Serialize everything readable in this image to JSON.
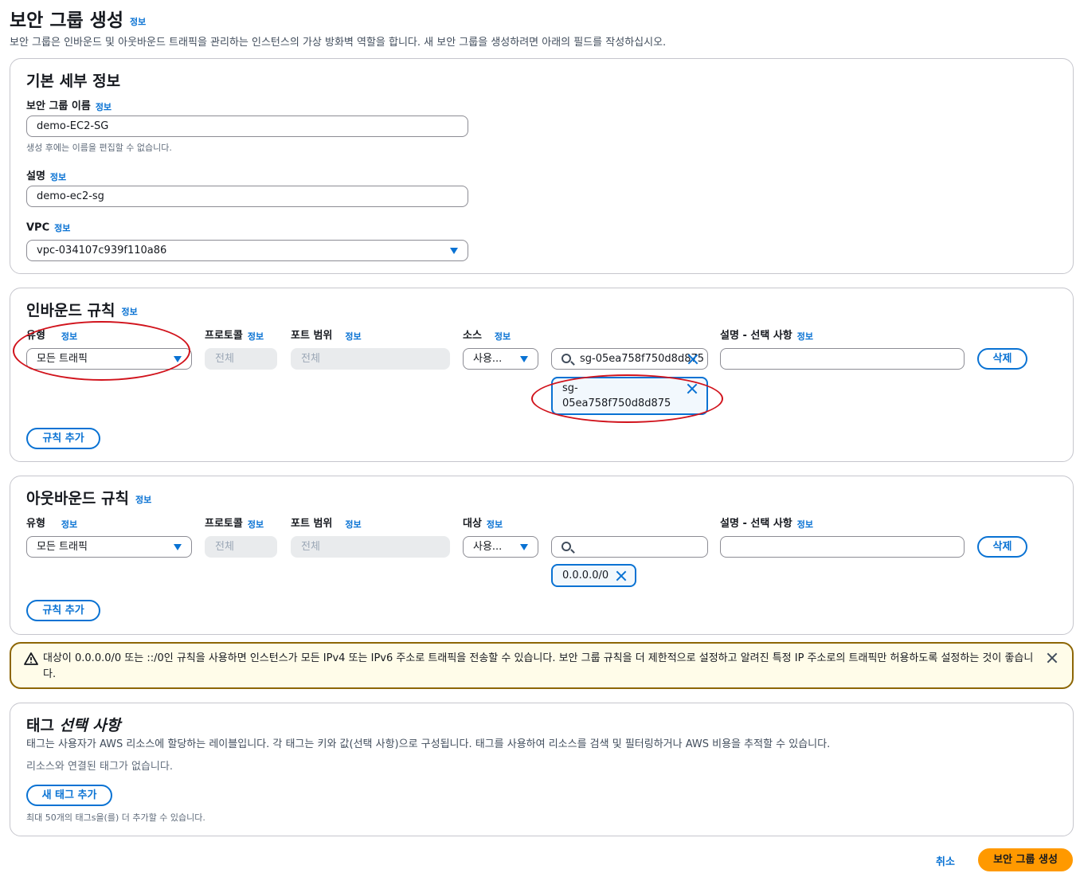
{
  "header": {
    "title": "보안 그룹 생성",
    "info": "정보",
    "description": "보안 그룹은 인바운드 및 아웃바운드 트래픽을 관리하는 인스턴스의 가상 방화벽 역할을 합니다. 새 보안 그룹을 생성하려면 아래의 필드를 작성하십시오."
  },
  "basic": {
    "title": "기본 세부 정보",
    "name_label": "보안 그룹 이름",
    "name_value": "demo-EC2-SG",
    "name_hint": "생성 후에는 이름을 편집할 수 없습니다.",
    "desc_label": "설명",
    "desc_value": "demo-ec2-sg",
    "vpc_label": "VPC",
    "vpc_value": "vpc-034107c939f110a86"
  },
  "inbound": {
    "title": "인바운드 규칙",
    "col_type": "유형",
    "col_protocol": "프로토콜",
    "col_port": "포트 범위",
    "col_source": "소스",
    "col_desc": "설명 - 선택 사항",
    "type_value": "모든 트래픽",
    "protocol_value": "전체",
    "port_value": "전체",
    "source_select": "사용...",
    "source_search": "sg-05ea758f750d8d875",
    "source_token_line1": "sg-",
    "source_token_line2": "05ea758f750d8d875",
    "delete_label": "삭제",
    "add_rule_label": "규칙 추가"
  },
  "outbound": {
    "title": "아웃바운드 규칙",
    "col_type": "유형",
    "col_protocol": "프로토콜",
    "col_port": "포트 범위",
    "col_dest": "대상",
    "col_desc": "설명 - 선택 사항",
    "type_value": "모든 트래픽",
    "protocol_value": "전체",
    "port_value": "전체",
    "dest_select": "사용...",
    "dest_token": "0.0.0.0/0",
    "delete_label": "삭제",
    "add_rule_label": "규칙 추가"
  },
  "alert": {
    "text": "대상이 0.0.0.0/0 또는 ::/0인 규칙을 사용하면 인스턴스가 모든 IPv4 또는 IPv6 주소로 트래픽을 전송할 수 있습니다. 보안 그룹 규칙을 더 제한적으로 설정하고 알려진 특정 IP 주소로의 트래픽만 허용하도록 설정하는 것이 좋습니다."
  },
  "tags": {
    "title": "태그",
    "title_optional": "선택 사항",
    "description": "태그는 사용자가 AWS 리소스에 할당하는 레이블입니다. 각 태그는 키와 값(선택 사항)으로 구성됩니다. 태그를 사용하여 리소스를 검색 및 필터링하거나 AWS 비용을 추적할 수 있습니다.",
    "empty": "리소스와 연결된 태그가 없습니다.",
    "add_label": "새 태그 추가",
    "limit_hint": "최대 50개의 태그s을(를) 더 추가할 수 있습니다."
  },
  "footer": {
    "cancel_label": "취소",
    "create_label": "보안 그룹 생성"
  },
  "colors": {
    "accent": "#0972d3",
    "primary_button": "#ff9900",
    "annotation": "#d1131c",
    "warning_border": "#8d6605"
  }
}
